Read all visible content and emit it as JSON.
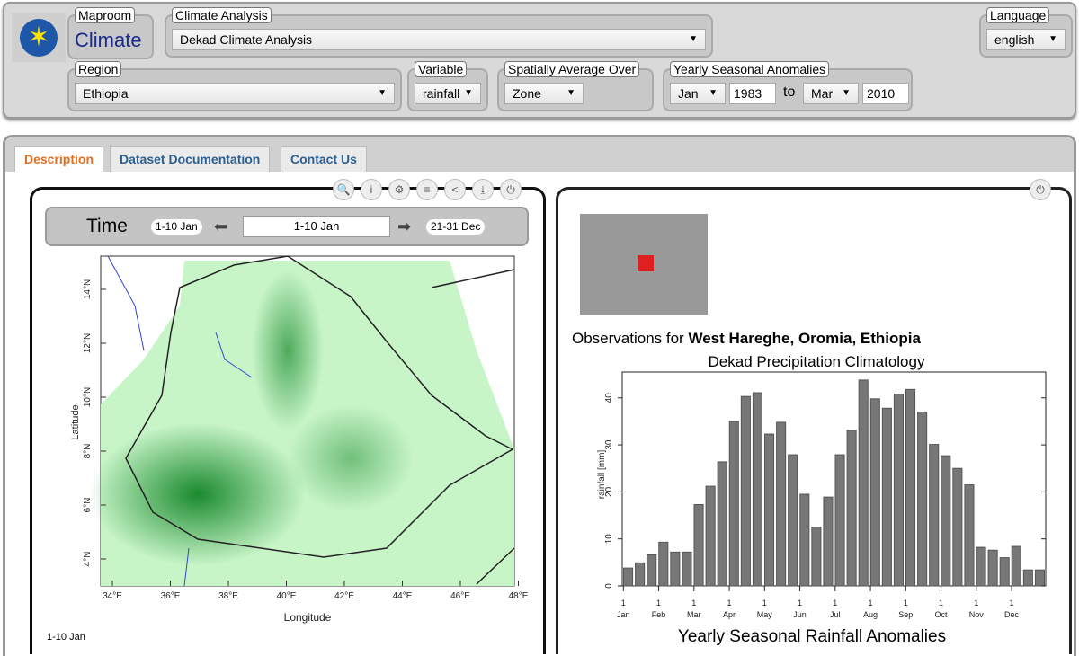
{
  "header": {
    "maproom": {
      "legend": "Maproom",
      "value": "Climate"
    },
    "analysis": {
      "legend": "Climate Analysis",
      "value": "Dekad Climate Analysis"
    },
    "language": {
      "legend": "Language",
      "value": "english"
    },
    "region": {
      "legend": "Region",
      "value": "Ethiopia"
    },
    "variable": {
      "legend": "Variable",
      "value": "rainfall"
    },
    "spatial": {
      "legend": "Spatially Average Over",
      "value": "Zone"
    },
    "anomalies": {
      "legend": "Yearly Seasonal Anomalies",
      "start_month": "Jan",
      "start_year": "1983",
      "to": "to",
      "end_month": "Mar",
      "end_year": "2010"
    }
  },
  "tabs": [
    {
      "label": "Description",
      "active": true
    },
    {
      "label": "Dataset Documentation"
    },
    {
      "label": "Contact Us"
    }
  ],
  "map_panel": {
    "toolbar_icons": [
      "zoom-icon",
      "info-icon",
      "gear-icon",
      "list-icon",
      "share-icon",
      "download-icon",
      "power-icon"
    ],
    "time": {
      "label": "Time",
      "first": "1-10 Jan",
      "current": "1-10 Jan",
      "last": "21-31 Dec"
    },
    "xticks": [
      "34°E",
      "36°E",
      "38°E",
      "40°E",
      "42°E",
      "44°E",
      "46°E",
      "48°E"
    ],
    "yticks": [
      "4°N",
      "6°N",
      "8°N",
      "10°N",
      "12°N",
      "14°N"
    ],
    "xlabel": "Longitude",
    "ylabel": "Latitude",
    "footer": "1-10 Jan",
    "colors": {
      "wet": "#1a8a2e",
      "dry": "#c8f5c8"
    }
  },
  "chart_panel": {
    "obs_prefix": "Observations for ",
    "obs_location": "West Hareghe, Oromia, Ethiopia",
    "bottom_title": "Yearly Seasonal Rainfall Anomalies"
  },
  "chart_data": {
    "type": "bar",
    "title": "Dekad Precipitation Climatology",
    "ylabel": "rainfall [mm]",
    "ylim": [
      0,
      45.5
    ],
    "yticks": [
      0,
      10,
      20,
      30,
      40
    ],
    "xtick_day": "1",
    "months": [
      "Jan",
      "Feb",
      "Mar",
      "Apr",
      "May",
      "Jun",
      "Jul",
      "Aug",
      "Sep",
      "Oct",
      "Nov",
      "Dec"
    ],
    "values": [
      3.8,
      4.9,
      6.6,
      9.3,
      7.2,
      7.2,
      17.3,
      21.2,
      26.4,
      35,
      40.3,
      41.1,
      32.3,
      34.8,
      27.9,
      19.5,
      12.5,
      18.9,
      27.9,
      33.1,
      43.8,
      39.8,
      37.8,
      40.8,
      41.8,
      37,
      30.1,
      27.7,
      25,
      21.5,
      8.2,
      7.6,
      6,
      8.4,
      3.4,
      3.4
    ],
    "bar_color": "#777777"
  }
}
